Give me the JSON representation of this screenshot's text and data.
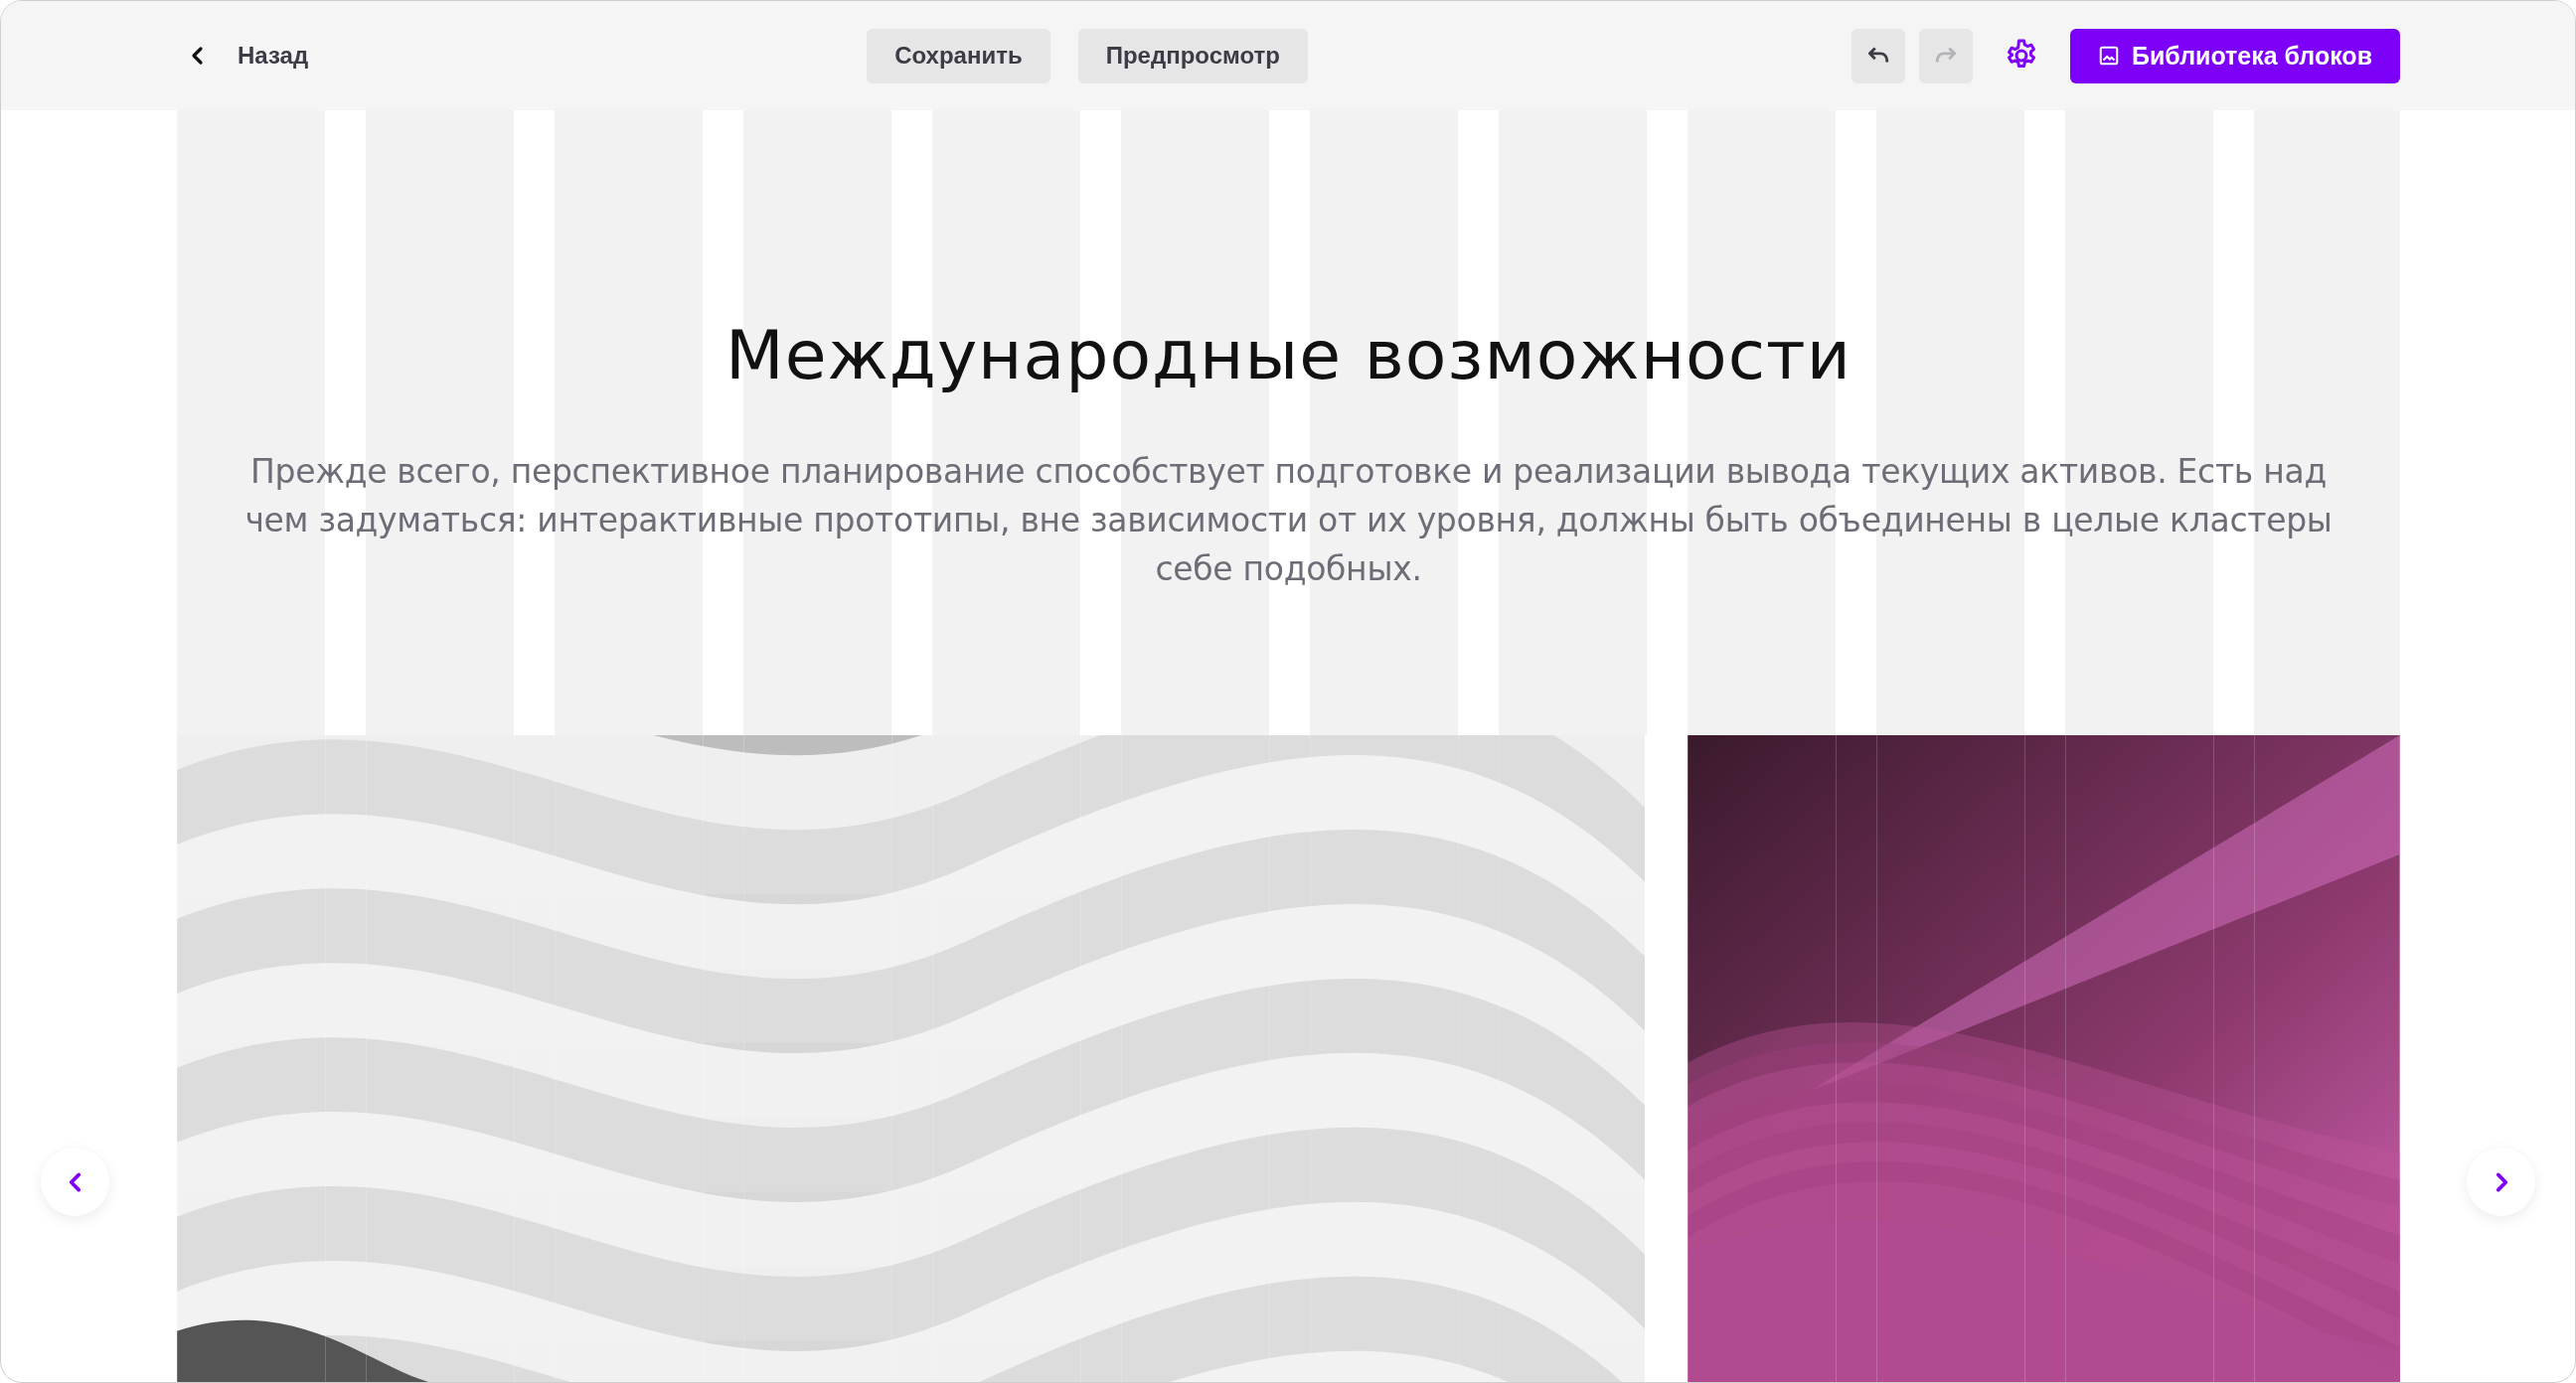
{
  "toolbar": {
    "back": {
      "label": "Назад"
    },
    "buttons": [
      {
        "label": "Сохранить"
      },
      {
        "label": "Предпросмотр"
      }
    ],
    "history": [
      {
        "kind": "undo",
        "disabled": false
      },
      {
        "kind": "redo",
        "disabled": true
      }
    ],
    "library_button": {
      "label": "Библиотека блоков"
    }
  },
  "section": {
    "title": "Международные возможности",
    "text": "Прежде всего, перспективное планирование способствует подготовке и реализации вывода текущих активов. Есть над чем задуматься: интерактивные прототипы, вне зависимости от их уровня, должны быть объединены в целые кластеры себе подобных."
  }
}
